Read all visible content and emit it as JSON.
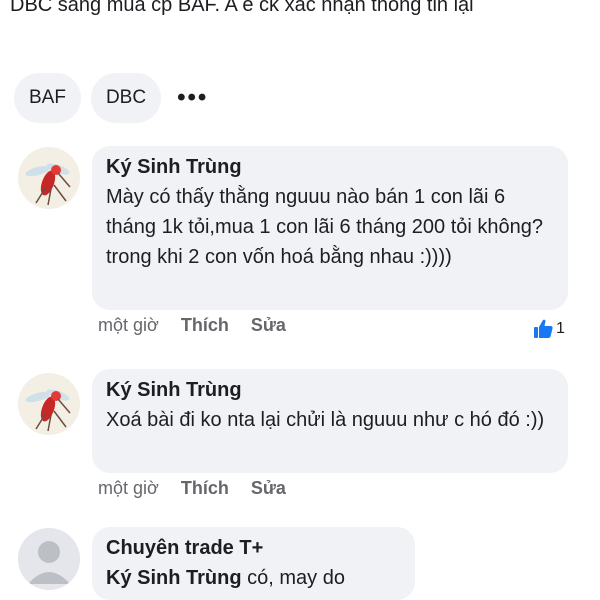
{
  "post": {
    "text": "DBC sang mua cp BAF. A e ck xác nhận thông tin lại"
  },
  "tags": [
    {
      "label": "BAF"
    },
    {
      "label": "DBC"
    }
  ],
  "more_label": "•••",
  "comments": [
    {
      "author": "Ký Sinh Trùng",
      "text": "Mày có thấy thằng nguuu nào bán 1 con lãi 6 tháng 1k tỏi,mua 1 con lãi 6 tháng 200 tỏi không?trong khi 2 con vốn hoá bằng nhau :))))",
      "time": "một giờ",
      "like_label": "Thích",
      "edit_label": "Sửa",
      "like_count": "1"
    },
    {
      "author": "Ký Sinh Trùng",
      "text": "Xoá bài đi ko nta lại chửi là nguuu như c hó đó :))",
      "time": "một giờ",
      "like_label": "Thích",
      "edit_label": "Sửa"
    },
    {
      "author": "Chuyên trade T+",
      "mention": "Ký Sinh Trùng",
      "text": "có, may do"
    }
  ],
  "colors": {
    "bubble": "#f0f2f5",
    "meta": "#65676b",
    "like_blue": "#1877f2"
  }
}
